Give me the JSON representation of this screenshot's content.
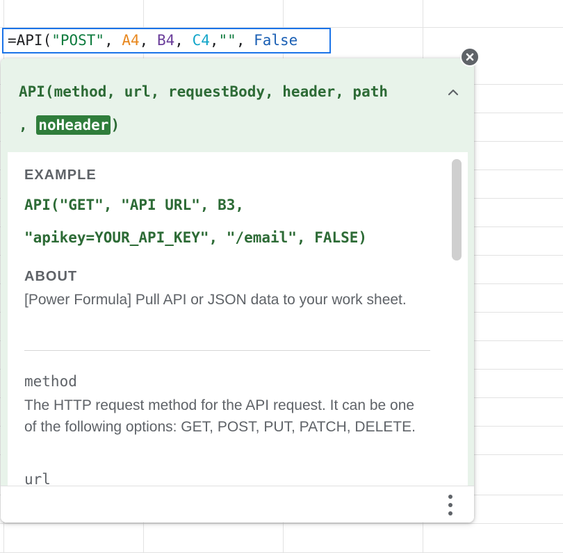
{
  "formula_bar": {
    "prefix": "=API(",
    "method_arg": "\"POST\"",
    "sep1": ", ",
    "ref1": "A4",
    "sep2": ", ",
    "ref2": "B4",
    "sep3": ", ",
    "ref3": "C4",
    "sep4": ",",
    "empty_arg": "\"\"",
    "sep5": ", ",
    "bool_arg": "False"
  },
  "tooltip": {
    "signature_line1": "API(method, url, requestBody, header, path",
    "signature_line2_prefix": ", ",
    "signature_active_param": "noHeader",
    "signature_line2_suffix": ")",
    "example_heading": "EXAMPLE",
    "example_line1": "API(\"GET\", \"API URL\", B3,",
    "example_line2": "\"apikey=YOUR_API_KEY\", \"/email\", FALSE)",
    "about_heading": "ABOUT",
    "about_text": "[Power Formula] Pull API or JSON data to your work sheet.",
    "params": [
      {
        "name": "method",
        "desc": "The HTTP request method for the API request. It can be one of the following options: GET, POST, PUT, PATCH, DELETE."
      },
      {
        "name": "url",
        "desc": ""
      }
    ]
  },
  "icons": {
    "close": "close-circle-icon",
    "collapse": "chevron-up-icon",
    "more": "more-vert-icon"
  },
  "colors": {
    "accent_blue": "#1a73e8",
    "signature_green": "#2d6b36",
    "highlight_green": "#2f7d3b",
    "panel_bg": "#e8f3ea"
  }
}
